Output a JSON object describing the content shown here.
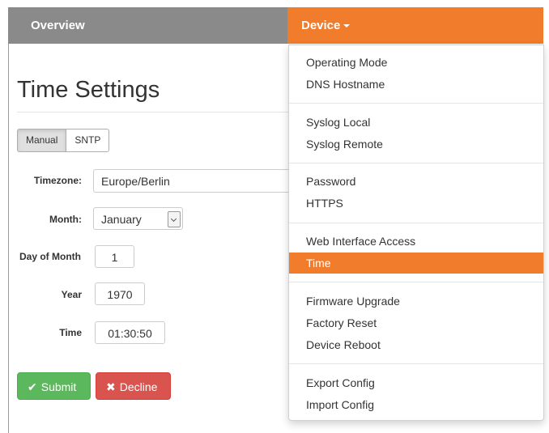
{
  "navbar": {
    "overview_label": "Overview",
    "device_label": "Device"
  },
  "page": {
    "title": "Time Settings"
  },
  "mode_toggle": {
    "manual_label": "Manual",
    "sntp_label": "SNTP",
    "selected": "Manual"
  },
  "form": {
    "timezone_label": "Timezone:",
    "timezone_value": "Europe/Berlin",
    "month_label": "Month:",
    "month_value": "January",
    "day_label": "Day of Month",
    "day_value": "1",
    "year_label": "Year",
    "year_value": "1970",
    "time_label": "Time",
    "time_value": "01:30:50"
  },
  "actions": {
    "submit_label": "Submit",
    "decline_label": "Decline",
    "submit_icon": "check-icon",
    "decline_icon": "x-icon"
  },
  "device_menu": {
    "items": [
      {
        "label": "Operating Mode"
      },
      {
        "label": "DNS Hostname"
      },
      {
        "label": "Syslog Local"
      },
      {
        "label": "Syslog Remote"
      },
      {
        "label": "Password"
      },
      {
        "label": "HTTPS"
      },
      {
        "label": "Web Interface Access"
      },
      {
        "label": "Time"
      },
      {
        "label": "Firmware Upgrade"
      },
      {
        "label": "Factory Reset"
      },
      {
        "label": "Device Reboot"
      },
      {
        "label": "Export Config"
      },
      {
        "label": "Import Config"
      }
    ],
    "active_item": "Time"
  },
  "colors": {
    "accent": "#f07c2c",
    "navbar_gray": "#8a8a8a",
    "success": "#5cb85c",
    "danger": "#d9534f"
  }
}
